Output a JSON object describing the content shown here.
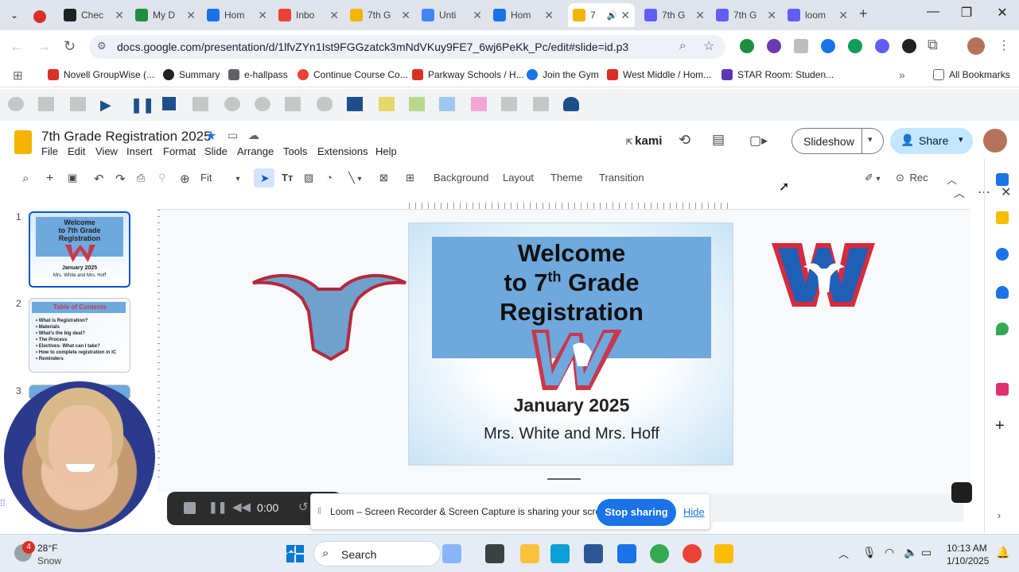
{
  "browser": {
    "tabs": [
      {
        "label": "Chec",
        "color": "#202124"
      },
      {
        "label": "My D",
        "color": "#1e8e3e"
      },
      {
        "label": "Hom",
        "color": "#1a73e8"
      },
      {
        "label": "Inbo",
        "color": "#ea4335"
      },
      {
        "label": "7th G",
        "color": "#f4b400"
      },
      {
        "label": "Unti",
        "color": "#4285f4"
      },
      {
        "label": "Hom",
        "color": "#1a73e8"
      },
      {
        "label": "7",
        "color": "#f4b400"
      },
      {
        "label": "7th G",
        "color": "#625df5"
      },
      {
        "label": "7th G",
        "color": "#625df5"
      },
      {
        "label": "loom",
        "color": "#625df5"
      }
    ],
    "url": "docs.google.com/presentation/d/1lfvZYn1Ist9FGGzatck3mNdVKuy9FE7_6wj6PeKk_Pc/edit#slide=id.p3",
    "bookmarks": [
      {
        "label": "Novell GroupWise (...",
        "color": "#d93025"
      },
      {
        "label": "Summary",
        "color": "#202124"
      },
      {
        "label": "e-hallpass",
        "color": "#5f6368"
      },
      {
        "label": "Continue Course Co...",
        "color": "#ea4335"
      },
      {
        "label": "Parkway Schools / H...",
        "color": "#d93025"
      },
      {
        "label": "Join the Gym",
        "color": "#1a73e8"
      },
      {
        "label": "West Middle / Hom...",
        "color": "#d93025"
      },
      {
        "label": "STAR Room: Studen...",
        "color": "#5e35b1"
      }
    ],
    "all_bookmarks": "All Bookmarks"
  },
  "slides": {
    "doc_title": "7th Grade Registration 2025",
    "menus": [
      "File",
      "Edit",
      "View",
      "Insert",
      "Format",
      "Slide",
      "Arrange",
      "Tools",
      "Extensions",
      "Help"
    ],
    "kami_label": "kami",
    "slideshow_label": "Slideshow",
    "share_label": "Share",
    "zoom_label": "Fit",
    "toolbar_text": [
      "Background",
      "Layout",
      "Theme",
      "Transition"
    ],
    "rec_label": "Rec",
    "thumb_numbers": [
      "1",
      "2",
      "3"
    ],
    "thumb1": {
      "line1": "Welcome",
      "line2": "to 7th Grade",
      "line3": "Registration",
      "line4": "January 2025",
      "line5": "Mrs. White and Mrs. Hoff"
    },
    "thumb2": {
      "title": "Table of Contents",
      "items": [
        "What is Registration?",
        "Materials",
        "What's the big deal?",
        "The Process",
        "Electives- What can I take?",
        "How to complete registration in IC",
        "Reminders"
      ]
    }
  },
  "slide": {
    "line1": "Welcome",
    "line2_a": "to 7",
    "line2_sup": "th",
    "line2_b": " Grade",
    "line3": "Registration",
    "date": "January 2025",
    "names": "Mrs. White and Mrs. Hoff"
  },
  "loom": {
    "timer": "0:00",
    "banner": "Loom – Screen Recorder & Screen Capture is sharing your screen.",
    "stop": "Stop sharing",
    "hide": "Hide"
  },
  "taskbar": {
    "weather_temp": "28°F",
    "weather_desc": "Snow",
    "weather_badge": "4",
    "search": "Search",
    "time": "10:13 AM",
    "date": "1/10/2025"
  }
}
